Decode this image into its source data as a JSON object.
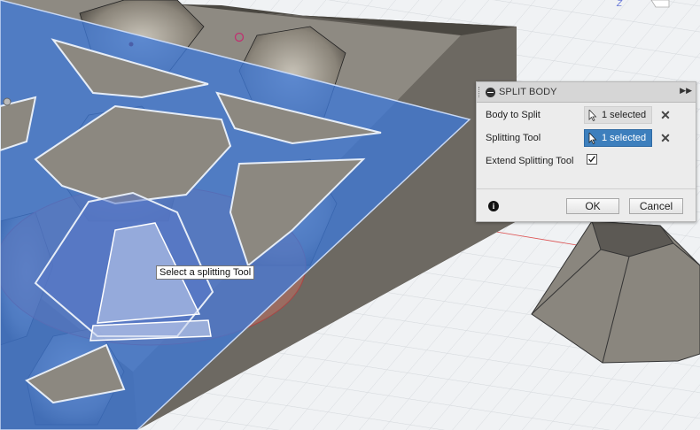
{
  "dialog": {
    "title": "SPLIT BODY",
    "rows": [
      {
        "label": "Body to Split",
        "value": "1 selected"
      },
      {
        "label": "Splitting Tool",
        "value": "1 selected"
      },
      {
        "label": "Extend Splitting Tool",
        "checked": true
      }
    ],
    "ok_label": "OK",
    "cancel_label": "Cancel",
    "clear_symbol": "✕",
    "info_symbol": "i",
    "expand_symbol": "▶▶"
  },
  "tooltip": {
    "text": "Select a splitting Tool"
  },
  "viewcube": {
    "axis_label": "Z"
  },
  "colors": {
    "accent": "#3d7fbd",
    "plane": "#3f78d6",
    "body": "#8c8880",
    "highlight": "#c07060"
  }
}
